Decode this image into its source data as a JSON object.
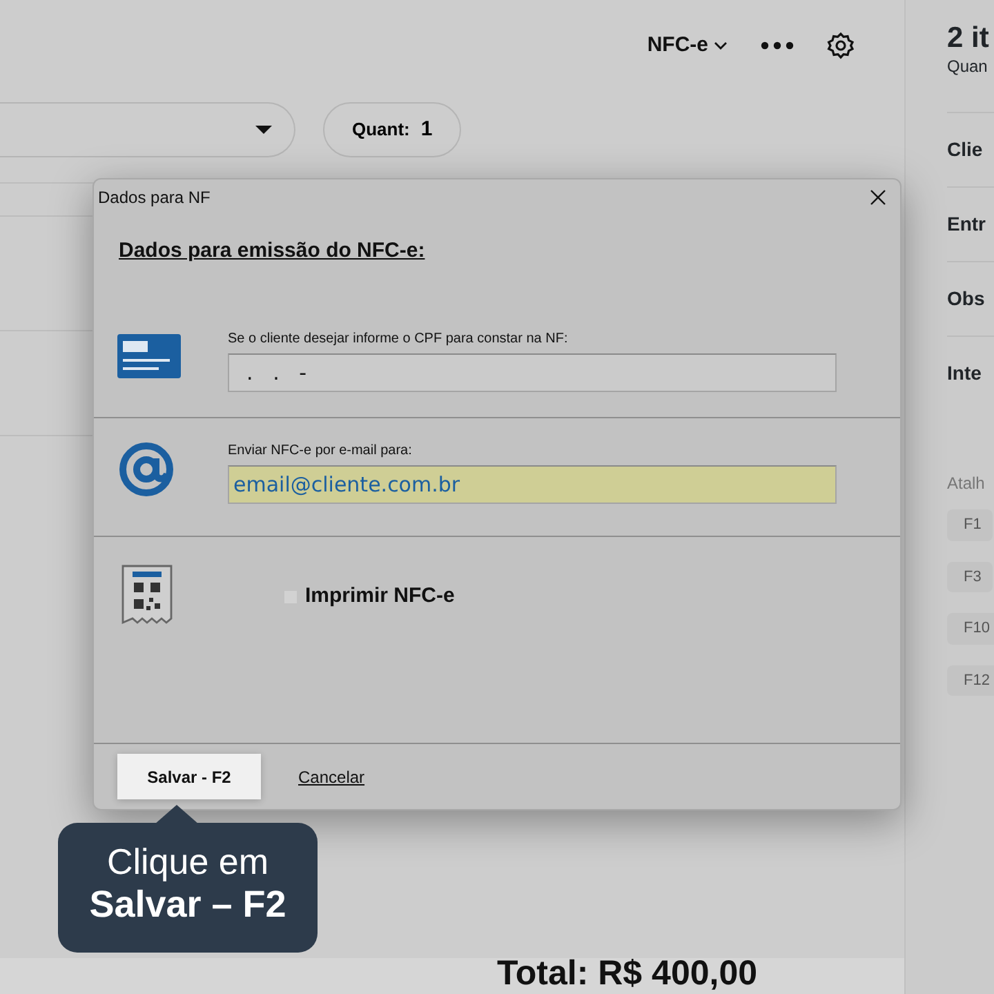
{
  "toolbar": {
    "document_type": "NFC-e"
  },
  "quantity": {
    "label": "Quant:",
    "value": "1"
  },
  "summary": {
    "title": "2 it",
    "subtitle": "Quan"
  },
  "sections": [
    "Clie",
    "Entr",
    "Obs",
    "Inte"
  ],
  "shortcuts": {
    "title": "Atalh",
    "keys": [
      "F1",
      "F3",
      "F10",
      "F12"
    ]
  },
  "dialog": {
    "title": "Dados para NF",
    "heading": "Dados para emissão do NFC-e:",
    "fields": [
      {
        "kind": "cpf",
        "label": "Se o cliente desejar informe o CPF para constar na NF:",
        "value": "  .   .   -",
        "focused": false
      },
      {
        "kind": "email",
        "label": "Enviar NFC-e por e-mail para:",
        "value": "email@cliente.com.br",
        "focused": true
      }
    ],
    "print_option": {
      "label": "Imprimir NFC-e",
      "checked": false
    },
    "buttons": [
      {
        "kind": "primary",
        "label": "Salvar - F2"
      },
      {
        "kind": "link",
        "label": "Cancelar"
      }
    ]
  },
  "tooltip": {
    "line_1": "Clique em",
    "line_2": "Salvar – F2"
  },
  "total": "Total: R$ 400,00"
}
